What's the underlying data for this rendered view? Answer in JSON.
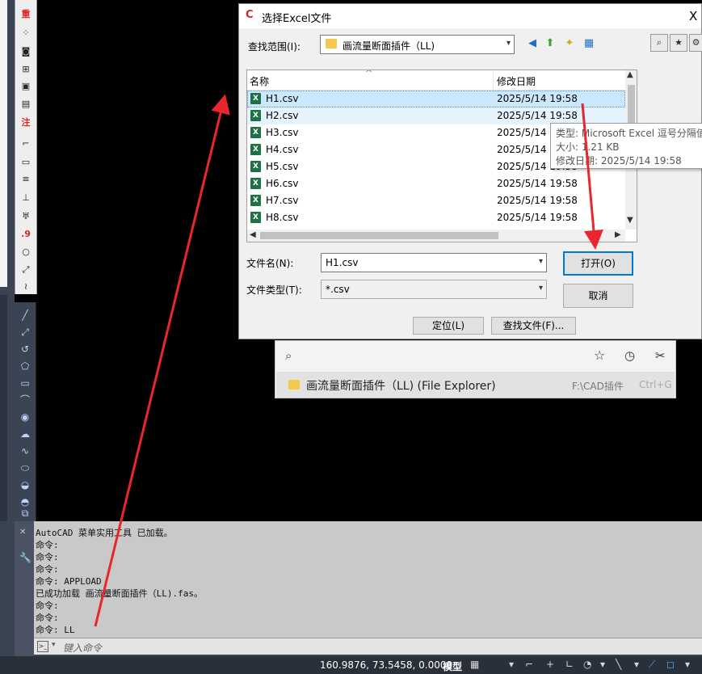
{
  "dialog": {
    "title": "选择Excel文件",
    "close_glyph": "X",
    "look_in_label": "查找范围(I):",
    "look_in_value": "画流量断面插件（LL)",
    "column_name": "名称",
    "column_date": "修改日期",
    "files": [
      {
        "name": "H1.csv",
        "date": "2025/5/14 19:58"
      },
      {
        "name": "H2.csv",
        "date": "2025/5/14 19:58"
      },
      {
        "name": "H3.csv",
        "date": "2025/5/14 19:58"
      },
      {
        "name": "H4.csv",
        "date": "2025/5/14 19:58"
      },
      {
        "name": "H5.csv",
        "date": "2025/5/14 19:58"
      },
      {
        "name": "H6.csv",
        "date": "2025/5/14 19:58"
      },
      {
        "name": "H7.csv",
        "date": "2025/5/14 19:58"
      },
      {
        "name": "H8.csv",
        "date": "2025/5/14 19:58"
      }
    ],
    "tooltip": {
      "type": "类型: Microsoft Excel 逗号分隔值文件",
      "size": "大小: 1.21 KB",
      "modified": "修改日期: 2025/5/14 19:58"
    },
    "filename_label": "文件名(N):",
    "filename_value": "H1.csv",
    "filetype_label": "文件类型(T):",
    "filetype_value": "*.csv",
    "open_label": "打开(O)",
    "cancel_label": "取消",
    "locate_label": "定位(L)",
    "find_label": "查找文件(F)..."
  },
  "quick_open": {
    "result_name": "画流量断面插件（LL)  (File Explorer)",
    "result_path": "F:\\CAD插件",
    "result_shortcut": "Ctrl+G"
  },
  "command": {
    "lines": [
      "AutoCAD 菜单实用工具 已加载。",
      "命令:",
      "命令:",
      "命令:",
      "命令: APPLOAD",
      "已成功加载 画流量断面插件（LL).fas。",
      "命令:",
      "命令:",
      "命令: LL"
    ],
    "input_placeholder": "键入命令"
  },
  "statusbar": {
    "coords": "160.9876, 73.5458, 0.0000",
    "model": "模型"
  },
  "colors": {
    "accent": "#0078d7",
    "selected_row": "#cce8ff",
    "arrow": "#e8262b"
  }
}
